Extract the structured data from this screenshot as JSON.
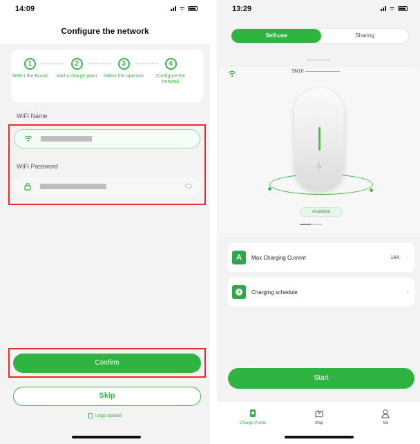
{
  "left": {
    "status_time": "14:09",
    "title": "Configure the network",
    "steps": [
      {
        "num": "1",
        "label": "Select the Brand"
      },
      {
        "num": "2",
        "label": "Add a charge point"
      },
      {
        "num": "3",
        "label": "Select the operator"
      },
      {
        "num": "4",
        "label": "Configure the network"
      }
    ],
    "wifi_name_label": "WiFi Name",
    "wifi_password_label": "WiFi Password",
    "confirm_label": "Confirm",
    "skip_label": "Skip",
    "logs_label": "Logs upload"
  },
  "right": {
    "status_time": "13:29",
    "tabs": [
      {
        "label": "Self-use",
        "active": true
      },
      {
        "label": "Sharing",
        "active": false
      }
    ],
    "serial": "SN10",
    "status_pill": "Available",
    "settings": [
      {
        "icon": "A",
        "label": "Max Charging Current",
        "value": "16A"
      },
      {
        "icon": "clock",
        "label": "Charging schedule",
        "value": ""
      }
    ],
    "chevron": "»",
    "start_label": "Start",
    "nav": [
      {
        "icon": "charge-point-icon",
        "label": "Charge Points"
      },
      {
        "icon": "map-icon",
        "label": "Map"
      },
      {
        "icon": "person-icon",
        "label": "Me"
      }
    ]
  },
  "colors": {
    "accent_green": "#2fb441",
    "highlight_red": "#ea2a2a"
  }
}
